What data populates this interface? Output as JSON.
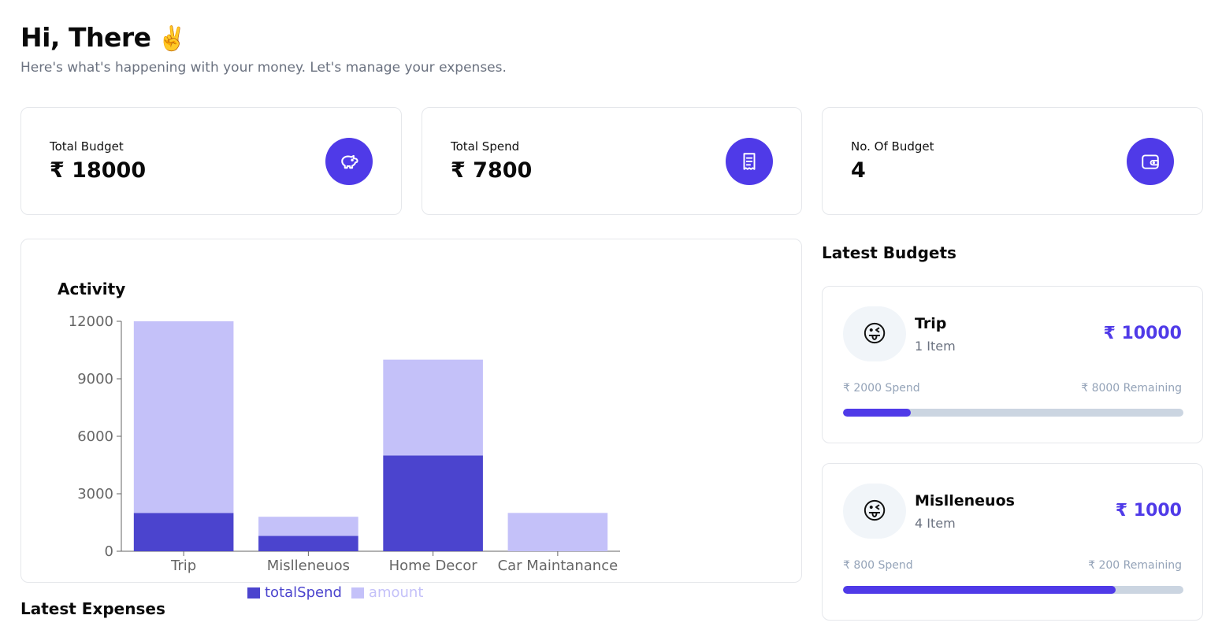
{
  "header": {
    "greeting": "Hi, There",
    "greeting_emoji": "✌️",
    "subtitle": "Here's what's happening with your money. Let's manage your expenses."
  },
  "stats": [
    {
      "label": "Total Budget",
      "value": "₹ 18000",
      "icon": "piggy-bank-icon"
    },
    {
      "label": "Total Spend",
      "value": "₹ 7800",
      "icon": "receipt-icon"
    },
    {
      "label": "No. Of Budget",
      "value": "4",
      "icon": "wallet-icon"
    }
  ],
  "activity": {
    "title": "Activity"
  },
  "chart_data": {
    "type": "bar",
    "stacked": true,
    "categories": [
      "Trip",
      "Mislleneuos",
      "Home Decor",
      "Car Maintanance"
    ],
    "series": [
      {
        "name": "totalSpend",
        "values": [
          2000,
          800,
          5000,
          0
        ],
        "color": "#4b44ce"
      },
      {
        "name": "amount",
        "values": [
          10000,
          1000,
          5000,
          2000
        ],
        "color": "#c4c1f9"
      }
    ],
    "yticks": [
      "0",
      "3000",
      "6000",
      "9000",
      "12000"
    ],
    "ylim": [
      0,
      12000
    ],
    "legend": "bottom",
    "grid": false
  },
  "latest_expenses": {
    "title": "Latest Expenses"
  },
  "latest_budgets": {
    "title": "Latest Budgets",
    "items": [
      {
        "emoji": "😜",
        "name": "Trip",
        "items": "1 Item",
        "amount": "₹ 10000",
        "spend": "₹ 2000 Spend",
        "remaining": "₹ 8000 Remaining",
        "progress": 0.2
      },
      {
        "emoji": "😜",
        "name": "Mislleneuos",
        "items": "4 Item",
        "amount": "₹ 1000",
        "spend": "₹ 800 Spend",
        "remaining": "₹ 200 Remaining",
        "progress": 0.8
      }
    ]
  },
  "colors": {
    "accent": "#4f3ae8",
    "bar_dark": "#4b44ce",
    "bar_light": "#c4c1f9"
  }
}
